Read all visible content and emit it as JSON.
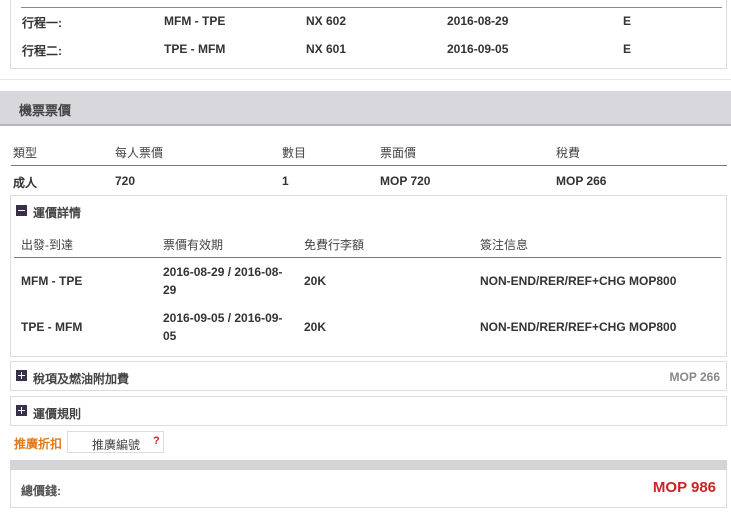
{
  "itinerary": {
    "rows": [
      {
        "label": "行程一:",
        "route": "MFM - TPE",
        "flight": "NX 602",
        "date": "2016-08-29",
        "class": "E"
      },
      {
        "label": "行程二:",
        "route": "TPE - MFM",
        "flight": "NX 601",
        "date": "2016-09-05",
        "class": "E"
      }
    ]
  },
  "fare_section": {
    "title": "機票票價",
    "headers": [
      "類型",
      "每人票價",
      "數目",
      "票面價",
      "稅費"
    ],
    "row": {
      "type": "成人",
      "per_person": "720",
      "count": "1",
      "face": "MOP 720",
      "tax": "MOP 266"
    }
  },
  "fare_details": {
    "title": "運價詳情",
    "headers": [
      "出發-到達",
      "票價有效期",
      "免費行李額",
      "簽注信息"
    ],
    "rows": [
      {
        "route": "MFM - TPE",
        "validity_1": "2016-08-29 / 2016-08-",
        "validity_2": "29",
        "baggage": "20K",
        "endorsement": "NON-END/RER/REF+CHG MOP800"
      },
      {
        "route": "TPE - MFM",
        "validity_1": "2016-09-05 / 2016-09-",
        "validity_2": "05",
        "baggage": "20K",
        "endorsement": "NON-END/RER/REF+CHG MOP800"
      }
    ]
  },
  "taxes": {
    "title": "稅項及燃油附加費",
    "value": "MOP 266"
  },
  "fare_rules": {
    "title": "運價規則"
  },
  "promo": {
    "label": "推廣折扣",
    "placeholder": "推廣編號",
    "help": "?"
  },
  "total": {
    "label": "總價錢:",
    "value": "MOP 986"
  }
}
